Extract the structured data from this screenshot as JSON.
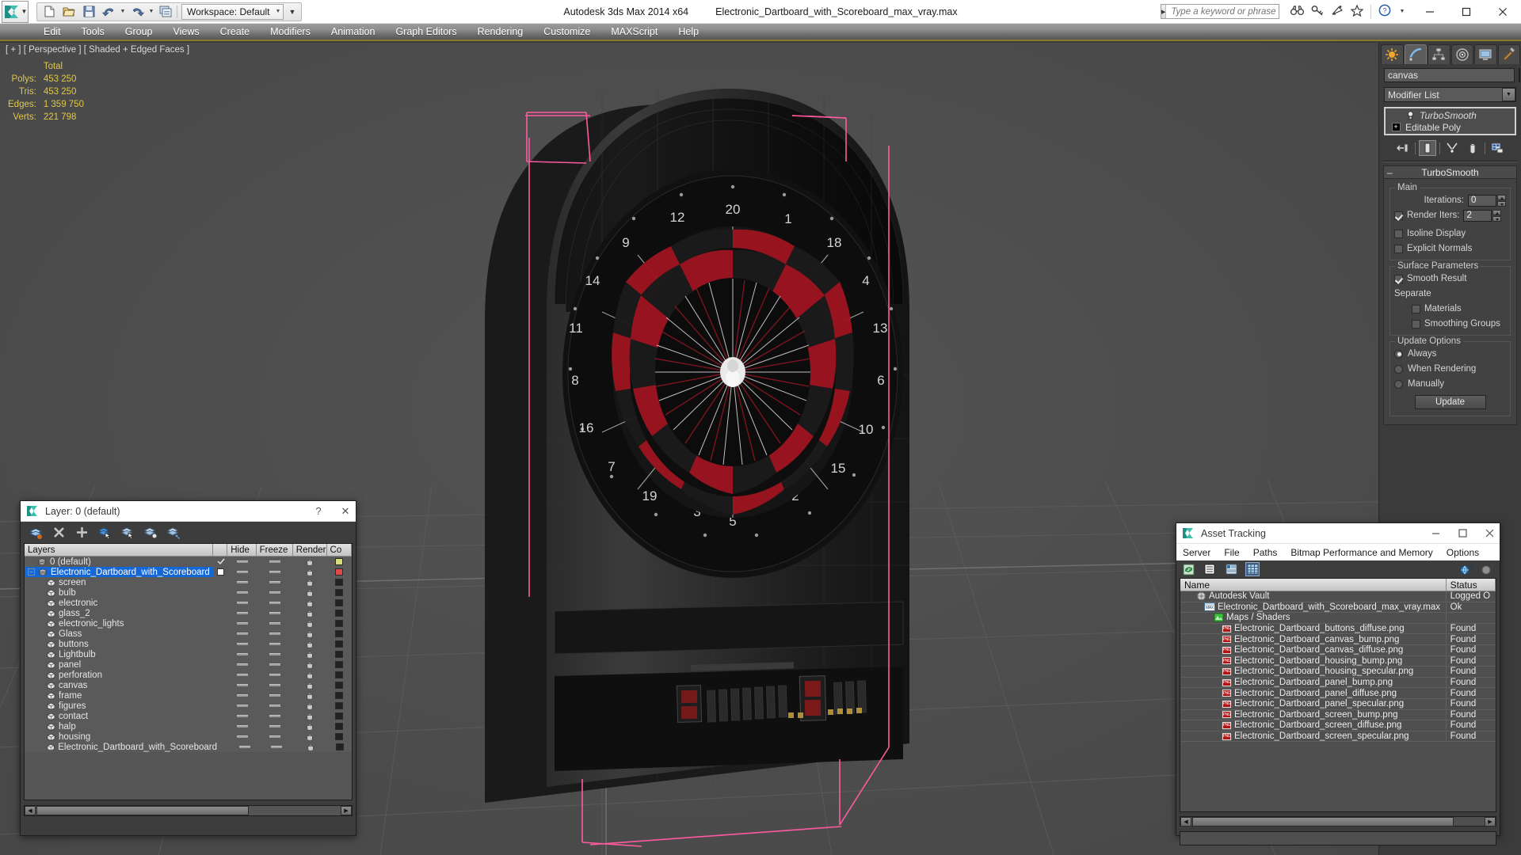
{
  "titlebar": {
    "workspace_label": "Workspace: Default",
    "app_title": "Autodesk 3ds Max  2014 x64",
    "document_title": "Electronic_Dartboard_with_Scoreboard_max_vray.max",
    "search_placeholder": "Type a keyword or phrase",
    "icons": [
      "new-icon",
      "open-icon",
      "save-icon",
      "undo-icon",
      "redo-icon",
      "scene-explorer-icon"
    ],
    "right_icons": [
      "binoculars-icon",
      "key-icon",
      "satellite-icon",
      "star-icon",
      "help-icon"
    ],
    "window_buttons": [
      "minimize",
      "maximize",
      "close"
    ]
  },
  "menubar": {
    "items": [
      "Edit",
      "Tools",
      "Group",
      "Views",
      "Create",
      "Modifiers",
      "Animation",
      "Graph Editors",
      "Rendering",
      "Customize",
      "MAXScript",
      "Help"
    ]
  },
  "viewport": {
    "label": "[ + ] [ Perspective ] [ Shaded + Edged Faces ]",
    "stats": {
      "header": "Total",
      "rows": [
        {
          "label": "Polys:",
          "value": "453 250"
        },
        {
          "label": "Tris:",
          "value": "453 250"
        },
        {
          "label": "Edges:",
          "value": "1 359 750"
        },
        {
          "label": "Verts:",
          "value": "221 798"
        }
      ]
    }
  },
  "command_panel": {
    "tabs": [
      "create-tab",
      "modify-tab",
      "hierarchy-tab",
      "motion-tab",
      "display-tab",
      "utilities-tab"
    ],
    "active_tab_index": 1,
    "object_name": "canvas",
    "modifier_list_label": "Modifier List",
    "stack": [
      {
        "label": "TurboSmooth",
        "icon": "lightbulb-icon",
        "italic": true
      },
      {
        "label": "Editable Poly",
        "icon": "plus-box-icon",
        "italic": false
      }
    ],
    "stack_tools": [
      "pin-stack-icon",
      "show-end-result-icon",
      "make-unique-icon",
      "remove-modifier-icon",
      "configure-modifier-sets-icon"
    ],
    "rollout": {
      "title": "TurboSmooth",
      "groups": {
        "main": {
          "title": "Main",
          "iterations_label": "Iterations:",
          "iterations_value": "0",
          "render_iters_label": "Render Iters:",
          "render_iters_value": "2",
          "render_iters_checked": true,
          "isoline_display_label": "Isoline Display",
          "isoline_display_checked": false,
          "explicit_normals_label": "Explicit Normals",
          "explicit_normals_checked": false
        },
        "surface": {
          "title": "Surface Parameters",
          "smooth_result_label": "Smooth Result",
          "smooth_result_checked": true,
          "separate_label": "Separate",
          "materials_label": "Materials",
          "materials_checked": false,
          "smoothing_groups_label": "Smoothing Groups",
          "smoothing_groups_checked": false
        },
        "update": {
          "title": "Update Options",
          "options": [
            {
              "label": "Always",
              "selected": true
            },
            {
              "label": "When Rendering",
              "selected": false
            },
            {
              "label": "Manually",
              "selected": false
            }
          ],
          "button_label": "Update"
        }
      }
    }
  },
  "layer_dialog": {
    "title": "Layer: 0 (default)",
    "help_label": "?",
    "close_label": "✕",
    "toolbar_icons": [
      "create-new-layer-icon",
      "delete-layer-icon",
      "add-selection-icon",
      "select-objects-icon",
      "select-highlighted-icon",
      "highlight-selected-icon",
      "hide-unselected-icon"
    ],
    "columns": [
      "Layers",
      "",
      "Hide",
      "Freeze",
      "Render",
      "Co"
    ],
    "rows": [
      {
        "name": "0 (default)",
        "indent": 1,
        "icon": "layer-icon",
        "selected": false,
        "active": true,
        "color": "#d8dd7a"
      },
      {
        "name": "Electronic_Dartboard_with_Scoreboard",
        "indent": 0,
        "icon": "layer-icon",
        "selected": true,
        "active": false,
        "expand": true,
        "color": "#e04a4a"
      },
      {
        "name": "screen",
        "indent": 2,
        "icon": "object-icon",
        "color": "#222222"
      },
      {
        "name": "bulb",
        "indent": 2,
        "icon": "object-icon",
        "color": "#222222"
      },
      {
        "name": "electronic",
        "indent": 2,
        "icon": "object-icon",
        "color": "#222222"
      },
      {
        "name": "glass_2",
        "indent": 2,
        "icon": "object-icon",
        "color": "#222222"
      },
      {
        "name": "electronic_lights",
        "indent": 2,
        "icon": "object-icon",
        "color": "#222222"
      },
      {
        "name": "Glass",
        "indent": 2,
        "icon": "object-icon",
        "color": "#222222"
      },
      {
        "name": "buttons",
        "indent": 2,
        "icon": "object-icon",
        "color": "#222222"
      },
      {
        "name": "Lightbulb",
        "indent": 2,
        "icon": "object-icon",
        "color": "#222222"
      },
      {
        "name": "panel",
        "indent": 2,
        "icon": "object-icon",
        "color": "#222222"
      },
      {
        "name": "perforation",
        "indent": 2,
        "icon": "object-icon",
        "color": "#222222"
      },
      {
        "name": "canvas",
        "indent": 2,
        "icon": "object-icon",
        "color": "#222222"
      },
      {
        "name": "frame",
        "indent": 2,
        "icon": "object-icon",
        "color": "#222222"
      },
      {
        "name": "figures",
        "indent": 2,
        "icon": "object-icon",
        "color": "#222222"
      },
      {
        "name": "contact",
        "indent": 2,
        "icon": "object-icon",
        "color": "#222222"
      },
      {
        "name": "halp",
        "indent": 2,
        "icon": "object-icon",
        "color": "#222222"
      },
      {
        "name": "housing",
        "indent": 2,
        "icon": "object-icon",
        "color": "#222222"
      },
      {
        "name": "Electronic_Dartboard_with_Scoreboard",
        "indent": 2,
        "icon": "object-icon",
        "color": "#222222"
      }
    ]
  },
  "asset_dialog": {
    "title": "Asset Tracking",
    "menu": [
      "Server",
      "File",
      "Paths",
      "Bitmap Performance and Memory",
      "Options"
    ],
    "toolbar_icons": [
      "refresh-icon",
      "list-view-icon",
      "details-view-icon",
      "grid-view-icon"
    ],
    "right_icons": [
      "help-globe-icon",
      "help-icon"
    ],
    "columns": [
      "Name",
      "Status"
    ],
    "rows": [
      {
        "name": "Autodesk Vault",
        "status": "Logged O",
        "icon": "vault-icon",
        "indent": 0
      },
      {
        "name": "Electronic_Dartboard_with_Scoreboard_max_vray.max",
        "status": "Ok",
        "icon": "max-icon",
        "indent": 1
      },
      {
        "name": "Maps / Shaders",
        "status": "",
        "icon": "maps-icon",
        "indent": 2
      },
      {
        "name": "Electronic_Dartboard_buttons_diffuse.png",
        "status": "Found",
        "icon": "png-icon",
        "indent": 3
      },
      {
        "name": "Electronic_Dartboard_canvas_bump.png",
        "status": "Found",
        "icon": "png-icon",
        "indent": 3
      },
      {
        "name": "Electronic_Dartboard_canvas_diffuse.png",
        "status": "Found",
        "icon": "png-icon",
        "indent": 3
      },
      {
        "name": "Electronic_Dartboard_housing_bump.png",
        "status": "Found",
        "icon": "png-icon",
        "indent": 3
      },
      {
        "name": "Electronic_Dartboard_housing_specular.png",
        "status": "Found",
        "icon": "png-icon",
        "indent": 3
      },
      {
        "name": "Electronic_Dartboard_panel_bump.png",
        "status": "Found",
        "icon": "png-icon",
        "indent": 3
      },
      {
        "name": "Electronic_Dartboard_panel_diffuse.png",
        "status": "Found",
        "icon": "png-icon",
        "indent": 3
      },
      {
        "name": "Electronic_Dartboard_panel_specular.png",
        "status": "Found",
        "icon": "png-icon",
        "indent": 3
      },
      {
        "name": "Electronic_Dartboard_screen_bump.png",
        "status": "Found",
        "icon": "png-icon",
        "indent": 3
      },
      {
        "name": "Electronic_Dartboard_screen_diffuse.png",
        "status": "Found",
        "icon": "png-icon",
        "indent": 3
      },
      {
        "name": "Electronic_Dartboard_screen_specular.png",
        "status": "Found",
        "icon": "png-icon",
        "indent": 3
      }
    ],
    "window_buttons": [
      "minimize",
      "maximize",
      "close"
    ]
  },
  "colors": {
    "accent_yellow": "#e0c84a",
    "selection_blue": "#1667d6",
    "gizmo_pink": "#ff5aa0",
    "viewport_bg": "#4c4c4c"
  }
}
